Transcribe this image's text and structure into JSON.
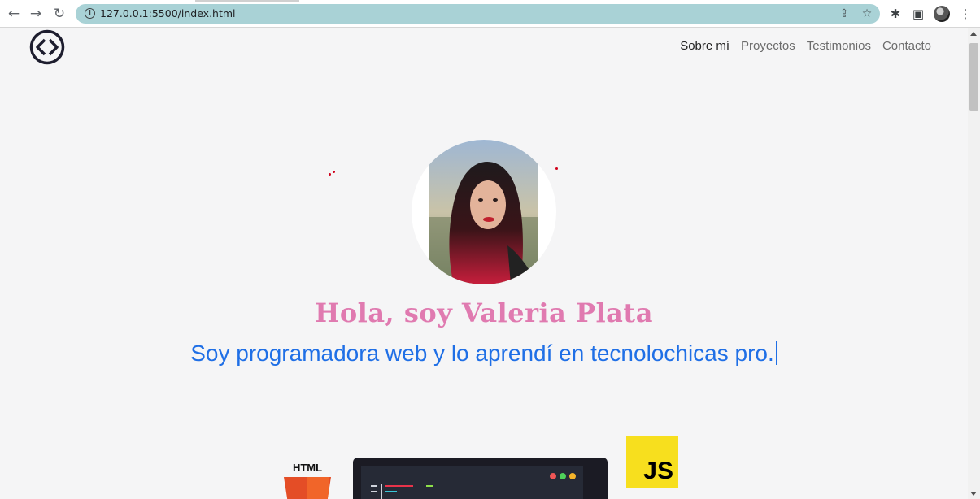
{
  "browser": {
    "url": "127.0.0.1:5500/index.html",
    "back_icon": "←",
    "forward_icon": "→",
    "reload_icon": "↻",
    "info_icon": "i",
    "share_icon": "⇪",
    "star_icon": "☆",
    "extensions_icon": "✱",
    "sidepanel_icon": "▣",
    "menu_icon": "⋮"
  },
  "nav": {
    "items": [
      "Sobre mí",
      "Proyectos",
      "Testimonios",
      "Contacto"
    ]
  },
  "hero": {
    "greeting": "Hola, soy Valeria Plata",
    "subtitle": "Soy programadora web y lo aprendí en tecnolochicas pro."
  },
  "tech": {
    "html_label": "HTML",
    "js_label": "JS"
  },
  "colors": {
    "accent_pink": "#e07ab0",
    "accent_blue": "#1f6fe6",
    "omnibox": "#a9d2d6"
  }
}
